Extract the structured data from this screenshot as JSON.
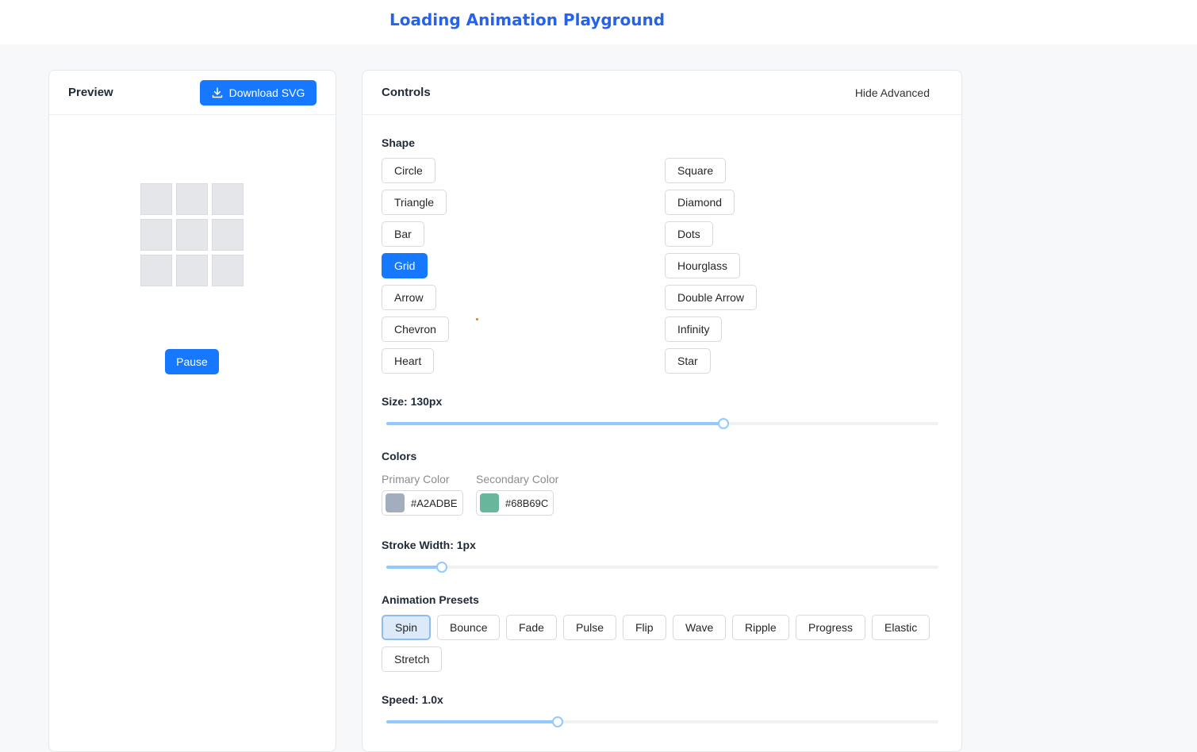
{
  "app": {
    "title": "Loading Animation Playground"
  },
  "preview": {
    "title": "Preview",
    "download_label": "Download SVG",
    "pause_label": "Pause",
    "grid_rows": 3,
    "grid_cols": 3
  },
  "controls": {
    "title": "Controls",
    "hide_advanced_label": "Hide Advanced",
    "shape": {
      "label": "Shape",
      "selected": "Grid",
      "left_column": [
        "Circle",
        "Triangle",
        "Bar",
        "Grid",
        "Arrow",
        "Chevron",
        "Heart"
      ],
      "right_column": [
        "Square",
        "Diamond",
        "Dots",
        "Hourglass",
        "Double Arrow",
        "Infinity",
        "Star"
      ]
    },
    "size": {
      "label": "Size: 130px",
      "fraction": 0.611
    },
    "colors": {
      "label": "Colors",
      "primary": {
        "label": "Primary Color",
        "value": "#A2ADBE",
        "swatch": "#A2ADBE"
      },
      "secondary": {
        "label": "Secondary Color",
        "value": "#68B69C",
        "swatch": "#68B69C"
      }
    },
    "stroke": {
      "label": "Stroke Width: 1px",
      "fraction": 0.1
    },
    "presets": {
      "label": "Animation Presets",
      "selected": "Spin",
      "row1": [
        "Spin",
        "Bounce",
        "Fade",
        "Pulse",
        "Flip",
        "Wave",
        "Ripple",
        "Progress",
        "Elastic"
      ],
      "row2": [
        "Stretch"
      ]
    },
    "speed": {
      "label": "Speed: 1.0x",
      "fraction": 0.31
    }
  },
  "icons": {
    "download": "download-icon"
  },
  "colors": {
    "accent": "#1677ff",
    "title": "#2563eb",
    "slider": "#91caff"
  }
}
